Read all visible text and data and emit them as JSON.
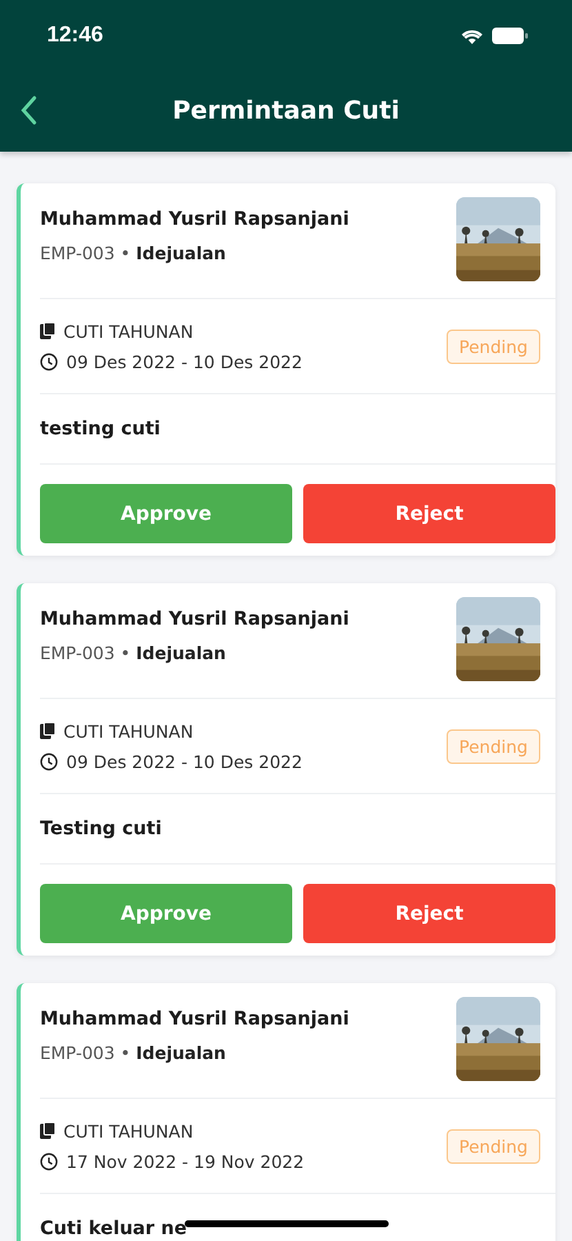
{
  "status_bar": {
    "time": "12:46"
  },
  "header": {
    "title": "Permintaan Cuti"
  },
  "requests": [
    {
      "name": "Muhammad Yusril Rapsanjani",
      "code": "EMP-003",
      "separator": "•",
      "company": "Idejualan",
      "photo": {
        "kind": "picture"
      },
      "leave_type": "CUTI TAHUNAN",
      "dates": "09 Des 2022 - 10 Des 2022",
      "status": {
        "label": "Pending",
        "kind": "pending"
      },
      "note": "testing cuti",
      "actions": [
        {
          "label": "Approve",
          "kind": "approve"
        },
        {
          "label": "Reject",
          "kind": "reject"
        }
      ]
    },
    {
      "name": "Muhammad Yusril Rapsanjani",
      "code": "EMP-003",
      "separator": "•",
      "company": "Idejualan",
      "photo": {
        "kind": "picture"
      },
      "leave_type": "CUTI TAHUNAN",
      "dates": "09 Des 2022 - 10 Des 2022",
      "status": {
        "label": "Pending",
        "kind": "pending"
      },
      "note": "Testing cuti",
      "actions": [
        {
          "label": "Approve",
          "kind": "approve"
        },
        {
          "label": "Reject",
          "kind": "reject"
        }
      ]
    },
    {
      "name": "Muhammad Yusril Rapsanjani",
      "code": "EMP-003",
      "separator": "•",
      "company": "Idejualan",
      "photo": {
        "kind": "picture"
      },
      "leave_type": "CUTI TAHUNAN",
      "dates": "17 Nov 2022 - 19 Nov 2022",
      "status": {
        "label": "Pending",
        "kind": "pending"
      },
      "note": "Cuti keluar ne"
    }
  ]
}
